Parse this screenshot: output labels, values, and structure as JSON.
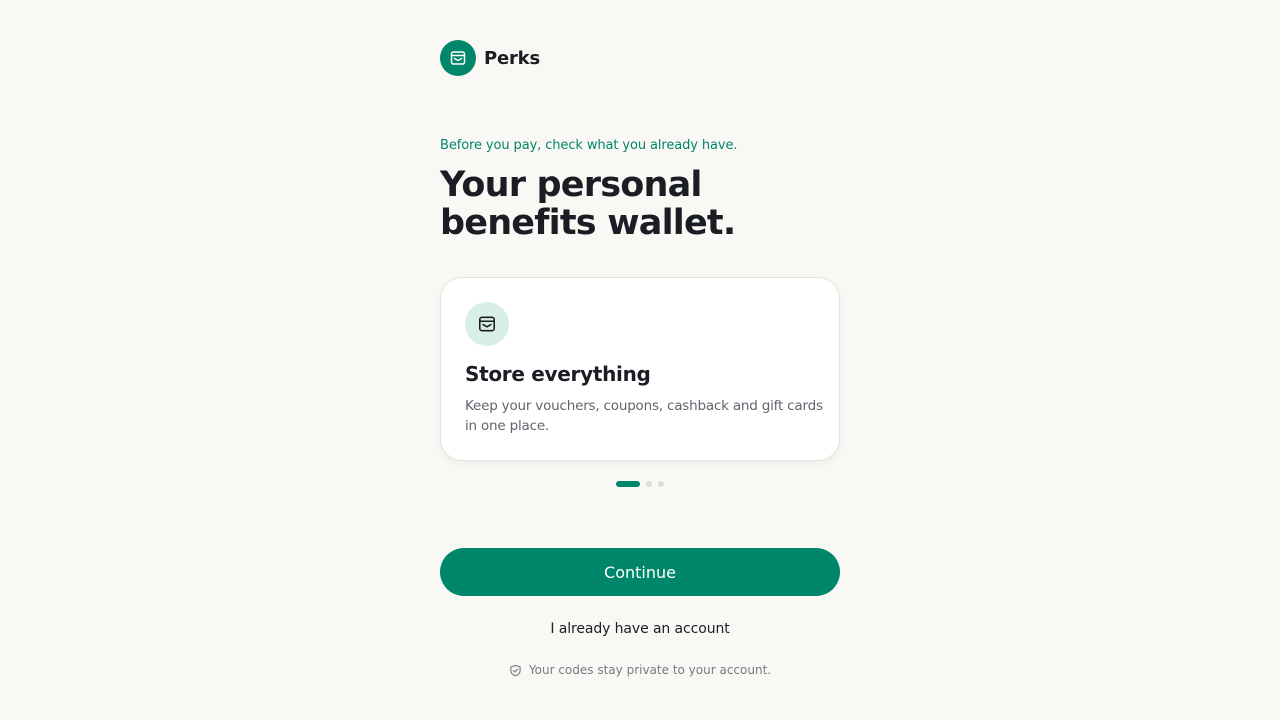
{
  "brand": {
    "name": "Perks",
    "logo_icon": "wallet-icon",
    "color": "#00866a"
  },
  "hero": {
    "eyebrow": "Before you pay, check what you already have.",
    "headline_line1": "Your personal",
    "headline_line2": "benefits wallet."
  },
  "card": {
    "icon": "wallet-icon",
    "title": "Store everything",
    "description": "Keep your vouchers, coupons, cashback and gift cards in one place."
  },
  "pagination": {
    "total": 3,
    "current": 1
  },
  "actions": {
    "continue_label": "Continue",
    "account_label": "I already have an account"
  },
  "footer": {
    "privacy_icon": "shield-check-icon",
    "privacy_text": "Your codes stay private to your account."
  },
  "colors": {
    "accent": "#00866a",
    "accent_light": "#d8efe5",
    "background": "#f9f8f4",
    "text": "#1a1d24"
  }
}
